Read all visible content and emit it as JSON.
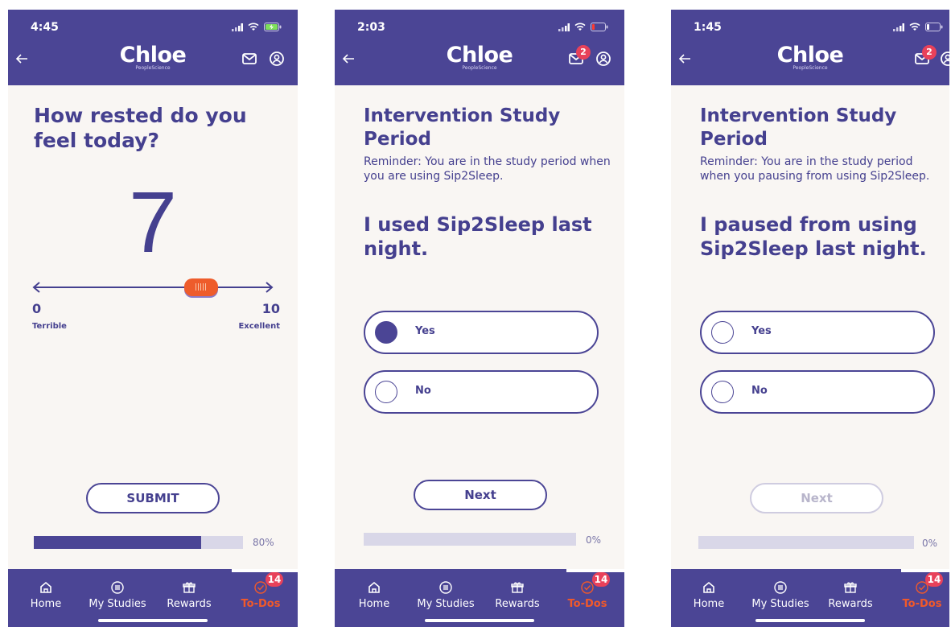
{
  "app": {
    "logo": "Chloe",
    "logo_sub": "PeopleScience"
  },
  "colors": {
    "brand": "#4b4595",
    "accent": "#ee5c2b",
    "active_tab": "#f1592a",
    "badge": "#e8415a",
    "background": "#f9f6f3"
  },
  "tabs": [
    {
      "label": "Home",
      "icon": "home-icon"
    },
    {
      "label": "My Studies",
      "icon": "list-icon"
    },
    {
      "label": "Rewards",
      "icon": "gift-icon"
    },
    {
      "label": "To-Dos",
      "icon": "check-circle-icon",
      "badge": "14",
      "active": true
    }
  ],
  "screen1": {
    "time": "4:45",
    "question": "How rested do you feel today?",
    "value": "7",
    "slider": {
      "min": 0,
      "max": 10,
      "value": 7,
      "min_label": "0",
      "max_label": "10",
      "min_text": "Terrible",
      "max_text": "Excellent"
    },
    "submit_label": "SUBMIT",
    "progress": {
      "value": 0.8,
      "text": "80%"
    }
  },
  "screen2": {
    "time": "2:03",
    "message_badge": "2",
    "title": "Intervention Study Period",
    "reminder": "Reminder: You are in the study period when you are using Sip2Sleep.",
    "question": "I used Sip2Sleep last night.",
    "options": [
      {
        "label": "Yes",
        "selected": true
      },
      {
        "label": "No",
        "selected": false
      }
    ],
    "next_label": "Next",
    "progress": {
      "value": 0,
      "text": "0%"
    }
  },
  "screen3": {
    "time": "1:45",
    "message_badge": "2",
    "title": "Intervention Study Period",
    "reminder": "Reminder: You are in the study period when you pausing from using Sip2Sleep.",
    "question": "I paused from using Sip2Sleep last night.",
    "options": [
      {
        "label": "Yes",
        "selected": false
      },
      {
        "label": "No",
        "selected": false
      }
    ],
    "next_label": "Next",
    "next_disabled": true,
    "progress": {
      "value": 0,
      "text": "0%"
    }
  }
}
